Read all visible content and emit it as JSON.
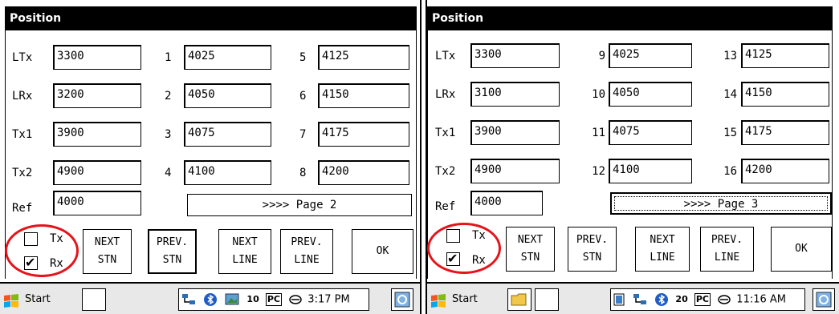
{
  "screens": [
    {
      "title": "Position",
      "rows": [
        {
          "label": "LTx",
          "value": "3300"
        },
        {
          "label": "LRx",
          "value": "3200"
        },
        {
          "label": "Tx1",
          "value": "3900"
        },
        {
          "label": "Tx2",
          "value": "4900"
        },
        {
          "label": "Ref",
          "value": "4000"
        }
      ],
      "col2": [
        {
          "num": "1",
          "value": "4025"
        },
        {
          "num": "2",
          "value": "4050"
        },
        {
          "num": "3",
          "value": "4075"
        },
        {
          "num": "4",
          "value": "4100"
        }
      ],
      "col3": [
        {
          "num": "5",
          "value": "4125"
        },
        {
          "num": "6",
          "value": "4150"
        },
        {
          "num": "7",
          "value": "4175"
        },
        {
          "num": "8",
          "value": "4200"
        }
      ],
      "page_button": ">>>> Page 2",
      "tx_label": "Tx",
      "tx_checked": false,
      "rx_label": "Rx",
      "rx_checked": true,
      "buttons": {
        "next_stn": [
          "NEXT",
          "STN"
        ],
        "prev_stn": [
          "PREV.",
          "STN"
        ],
        "next_line": [
          "NEXT",
          "LINE"
        ],
        "prev_line": [
          "PREV.",
          "LINE"
        ],
        "ok": "OK"
      },
      "taskbar": {
        "start": "Start",
        "time": "3:17 PM",
        "pc": "PC",
        "count": "10"
      }
    },
    {
      "title": "Position",
      "rows": [
        {
          "label": "LTx",
          "value": "3300"
        },
        {
          "label": "LRx",
          "value": "3100"
        },
        {
          "label": "Tx1",
          "value": "3900"
        },
        {
          "label": "Tx2",
          "value": "4900"
        },
        {
          "label": "Ref",
          "value": "4000"
        }
      ],
      "col2": [
        {
          "num": "9",
          "value": "4025"
        },
        {
          "num": "10",
          "value": "4050"
        },
        {
          "num": "11",
          "value": "4075"
        },
        {
          "num": "12",
          "value": "4100"
        }
      ],
      "col3": [
        {
          "num": "13",
          "value": "4125"
        },
        {
          "num": "14",
          "value": "4150"
        },
        {
          "num": "15",
          "value": "4175"
        },
        {
          "num": "16",
          "value": "4200"
        }
      ],
      "page_button": ">>>> Page 3",
      "tx_label": "Tx",
      "tx_checked": false,
      "rx_label": "Rx",
      "rx_checked": true,
      "buttons": {
        "next_stn": [
          "NEXT",
          "STN"
        ],
        "prev_stn": [
          "PREV.",
          "STN"
        ],
        "next_line": [
          "NEXT",
          "LINE"
        ],
        "prev_line": [
          "PREV.",
          "LINE"
        ],
        "ok": "OK"
      },
      "taskbar": {
        "start": "Start",
        "time": "11:16 AM",
        "pc": "PC",
        "count": "20"
      }
    }
  ],
  "check_mark": "✔",
  "highlight_color": "#e4141b"
}
